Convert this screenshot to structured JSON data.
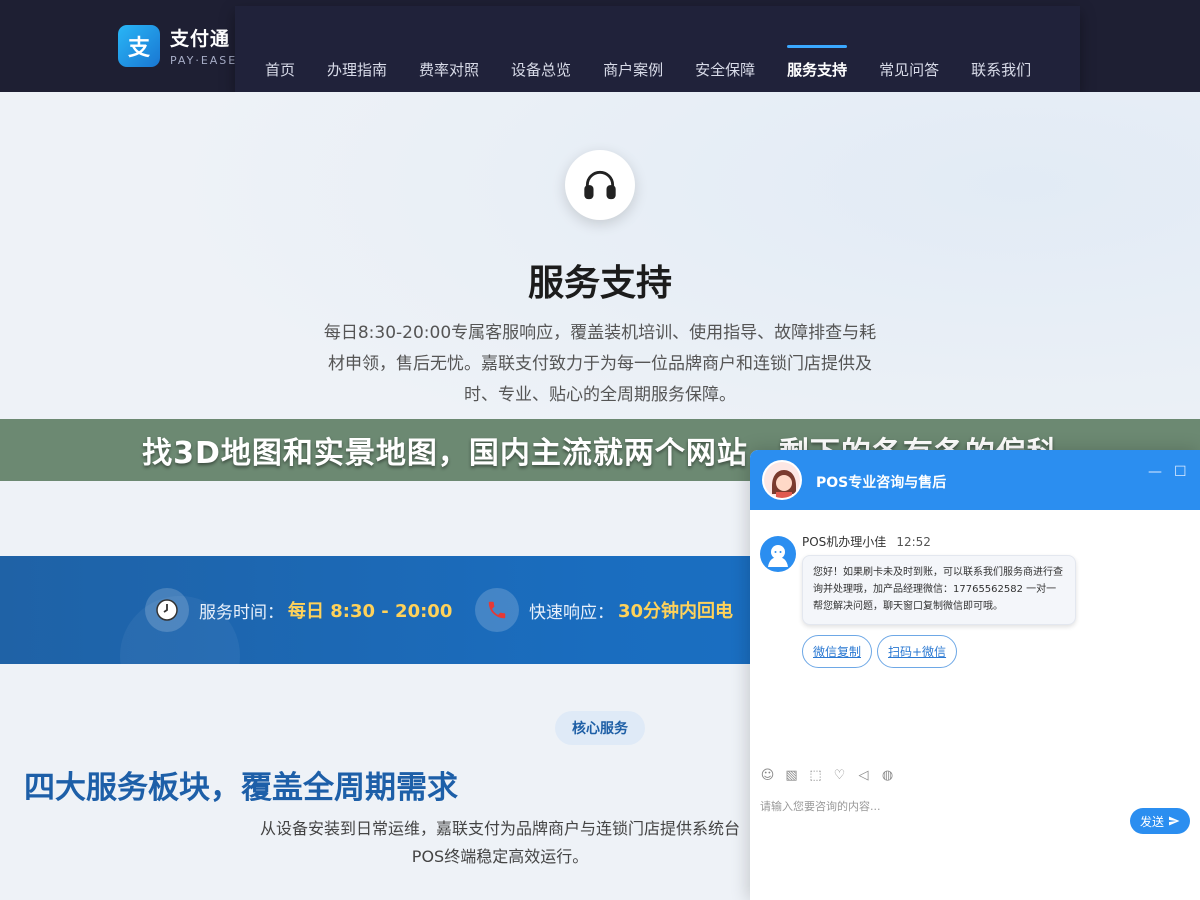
{
  "header": {
    "logo_mark": "支",
    "logo_name": "支付通",
    "logo_sub": "PAY·EASE",
    "nav": [
      {
        "label": "首页"
      },
      {
        "label": "办理指南"
      },
      {
        "label": "费率对照"
      },
      {
        "label": "设备总览"
      },
      {
        "label": "商户案例"
      },
      {
        "label": "安全保障"
      },
      {
        "label": "服务支持",
        "active": true
      },
      {
        "label": "常见问答"
      },
      {
        "label": "联系我们"
      }
    ]
  },
  "hero": {
    "icon": "headset-icon",
    "title": "服务支持",
    "description": "每日8:30-20:00专属客服响应，覆盖装机培训、使用指导、故障排查与耗材申领，售后无忧。嘉联支付致力于为每一位品牌商户和连锁门店提供及时、专业、贴心的全周期服务保障。",
    "partial_text": "30"
  },
  "banner": {
    "text": "找3D地图和实景地图，国内主流就两个网站，剩下的各有各的偏科"
  },
  "strip": {
    "service_time_label": "服务时间：",
    "service_time_value": "每日 8:30 - 20:00",
    "response_label": "快速响应：",
    "response_value": "30分钟内回电"
  },
  "section": {
    "pill": "核心服务",
    "title": "四大服务板块，覆盖全周期需求",
    "description": "从设备安装到日常运维，嘉联支付为品牌商户与连锁门店提供系统台POS终端稳定高效运行。"
  },
  "chat": {
    "title": "POS专业咨询与售后",
    "agent_name": "POS机办理小佳",
    "time": "12:52",
    "message": "您好！如果刷卡未及时到账，可以联系我们服务商进行查询并处理哦，加产品经理微信：17765562582 一对一帮您解决问题，聊天窗口复制微信即可哦。",
    "chips": [
      "微信复制",
      "扫码+微信"
    ],
    "input_placeholder": "请输入您要咨询的内容...",
    "send_label": "发送",
    "minimize": "—",
    "maximize": "☐"
  },
  "colors": {
    "nav_bg": "#1e1f33",
    "accent": "#2b8ef0",
    "strip_bg": "#1a6dbf",
    "highlight": "#ffd25a",
    "banner_bg": "#5a7a60"
  }
}
